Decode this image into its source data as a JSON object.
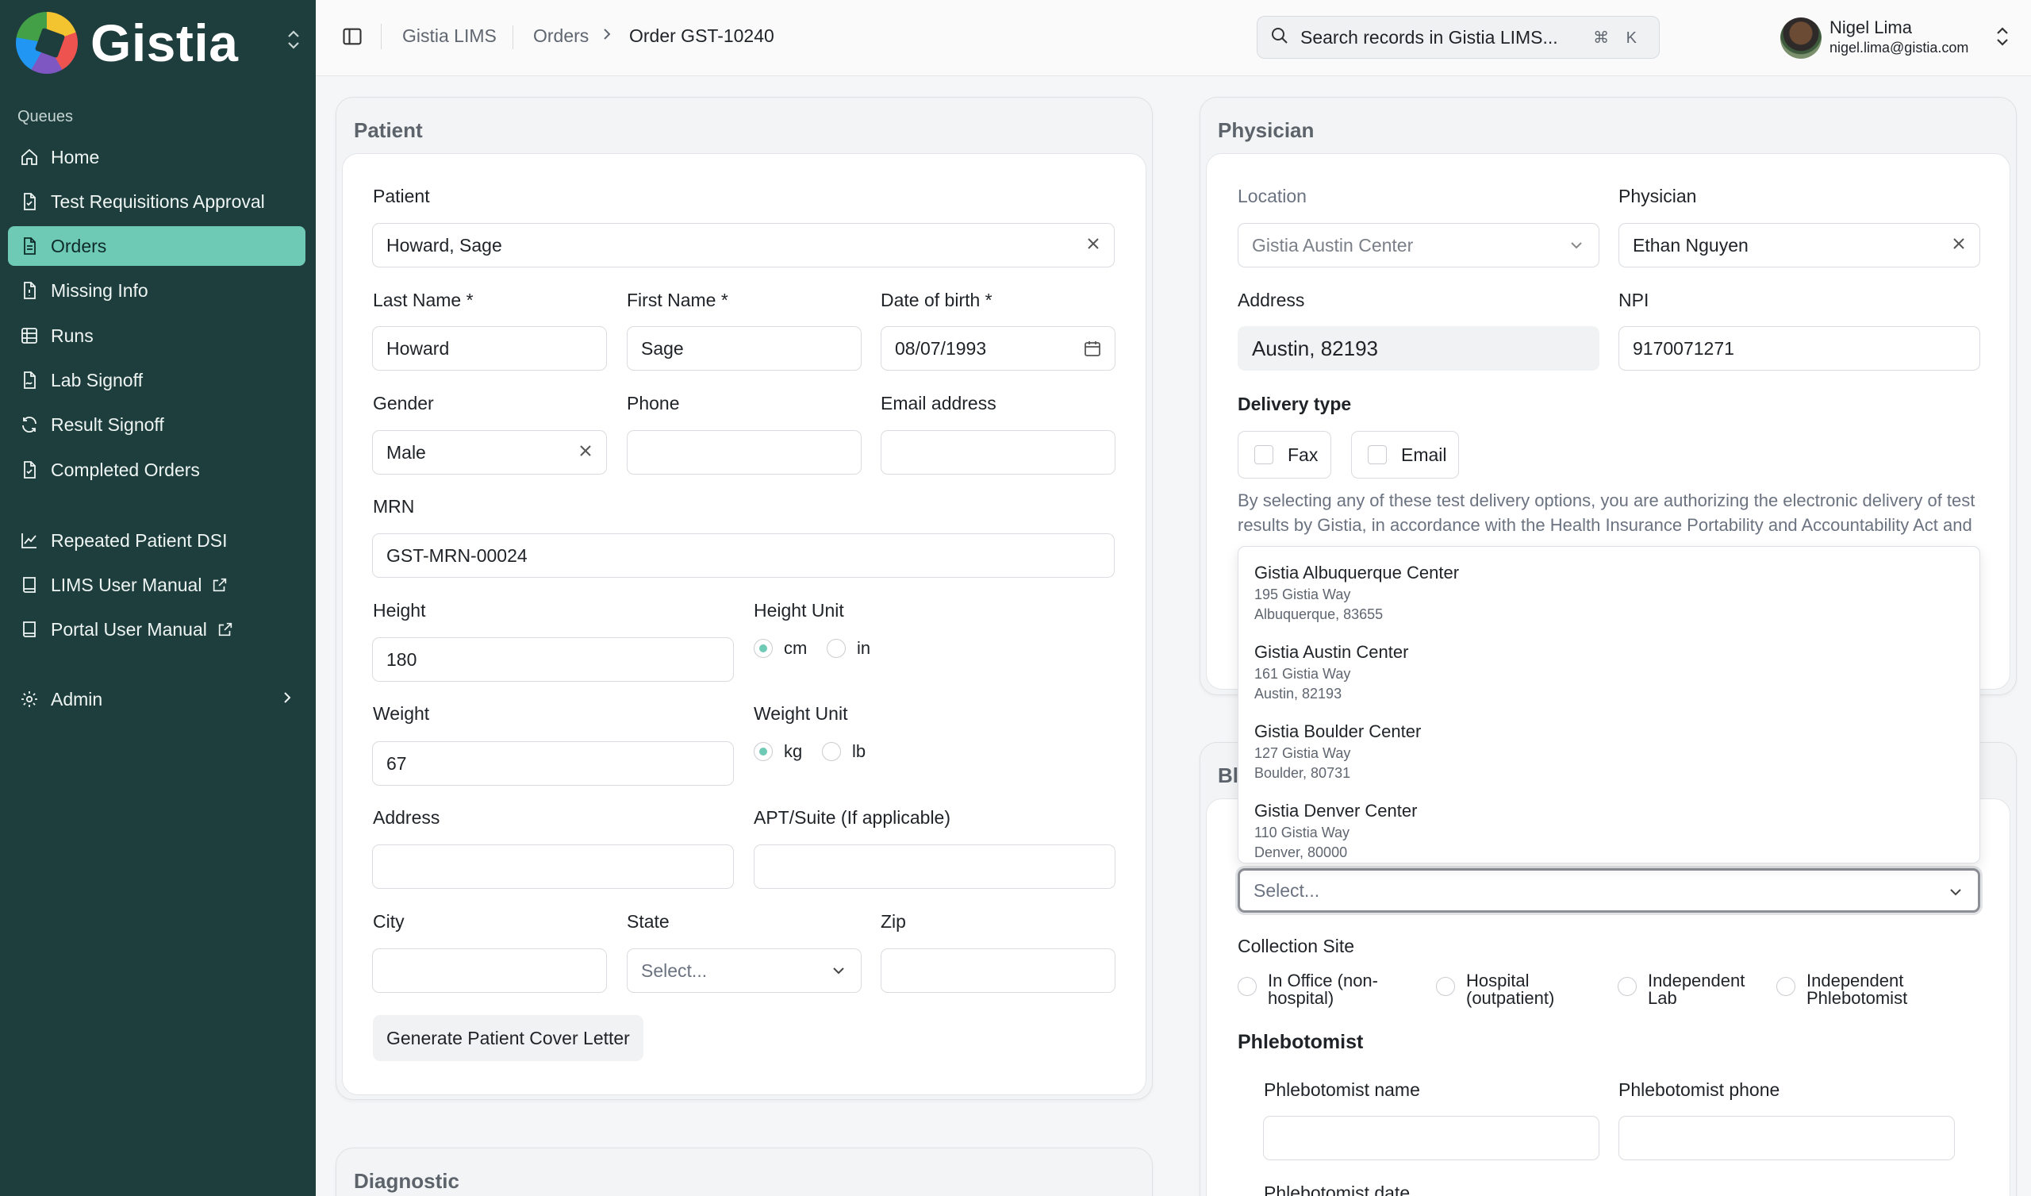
{
  "brand": {
    "name": "Gistia"
  },
  "sidebar": {
    "section_label": "Queues",
    "items": [
      {
        "label": "Home",
        "icon": "home-icon"
      },
      {
        "label": "Test Requisitions Approval",
        "icon": "file-check-icon"
      },
      {
        "label": "Orders",
        "icon": "file-text-icon",
        "active": true
      },
      {
        "label": "Missing Info",
        "icon": "file-alert-icon"
      },
      {
        "label": "Runs",
        "icon": "grid-icon"
      },
      {
        "label": "Lab Signoff",
        "icon": "file-signature-icon"
      },
      {
        "label": "Result Signoff",
        "icon": "refresh-icon"
      },
      {
        "label": "Completed Orders",
        "icon": "file-check-icon"
      }
    ],
    "links": [
      {
        "label": "Repeated Patient DSI",
        "icon": "chart-line-icon"
      },
      {
        "label": "LIMS User Manual",
        "icon": "book-icon"
      },
      {
        "label": "Portal User Manual",
        "icon": "book-icon"
      }
    ],
    "admin_label": "Admin"
  },
  "topbar": {
    "breadcrumb": [
      "Gistia LIMS",
      "Orders",
      "Order GST-10240"
    ],
    "search_placeholder": "Search records in Gistia LIMS...",
    "search_shortcut": "⌘ K",
    "user_name": "Nigel Lima",
    "user_email": "nigel.lima@gistia.com"
  },
  "patient": {
    "title": "Patient",
    "patient_label": "Patient",
    "patient_value": "Howard, Sage",
    "last_name_label": "Last Name *",
    "last_name": "Howard",
    "first_name_label": "First Name *",
    "first_name": "Sage",
    "dob_label": "Date of birth *",
    "dob": "08/07/1993",
    "gender_label": "Gender",
    "gender": "Male",
    "phone_label": "Phone",
    "phone": "",
    "email_label": "Email address",
    "email": "",
    "mrn_label": "MRN",
    "mrn": "GST-MRN-00024",
    "height_label": "Height",
    "height": "180",
    "height_unit_label": "Height Unit",
    "height_units": [
      "cm",
      "in"
    ],
    "height_unit_selected": "cm",
    "weight_label": "Weight",
    "weight": "67",
    "weight_unit_label": "Weight Unit",
    "weight_units": [
      "kg",
      "lb"
    ],
    "weight_unit_selected": "kg",
    "address_label": "Address",
    "address": "",
    "apt_label": "APT/Suite (If applicable)",
    "apt": "",
    "city_label": "City",
    "city": "",
    "state_label": "State",
    "state_placeholder": "Select...",
    "zip_label": "Zip",
    "zip": "",
    "cover_letter_button": "Generate Patient Cover Letter"
  },
  "diagnostic": {
    "title": "Diagnostic"
  },
  "physician": {
    "title": "Physician",
    "location_label": "Location",
    "location": "Gistia Austin Center",
    "physician_label": "Physician",
    "physician": "Ethan Nguyen",
    "address_label": "Address",
    "address": "Austin, 82193",
    "npi_label": "NPI",
    "npi": "9170071271",
    "delivery_label": "Delivery type",
    "delivery_options": [
      "Fax",
      "Email"
    ],
    "disclaimer_line1": "By selecting any of these test delivery options, you are authorizing the electronic delivery of test",
    "disclaimer_line2": "results by Gistia, in accordance with the Health Insurance Portability and Accountability Act and"
  },
  "location_dropdown": {
    "options": [
      {
        "name": "Gistia Albuquerque Center",
        "street": "195 Gistia Way",
        "city": "Albuquerque, 83655"
      },
      {
        "name": "Gistia Austin Center",
        "street": "161 Gistia Way",
        "city": "Austin, 82193"
      },
      {
        "name": "Gistia Boulder Center",
        "street": "127 Gistia Way",
        "city": "Boulder, 80731"
      },
      {
        "name": "Gistia Denver Center",
        "street": "110 Gistia Way",
        "city": "Denver, 80000"
      }
    ]
  },
  "blood": {
    "title_partial": "Bl",
    "select_placeholder": "Select...",
    "collection_site_label": "Collection Site",
    "collection_sites": [
      [
        "In Office (non-",
        "hospital)"
      ],
      [
        "Hospital",
        "(outpatient)"
      ],
      [
        "Independent",
        "Lab"
      ],
      [
        "Independent",
        "Phlebotomist"
      ]
    ],
    "phlebotomist_title": "Phlebotomist",
    "phlebotomist_name_label": "Phlebotomist name",
    "phlebotomist_phone_label": "Phlebotomist phone",
    "phlebotomist_date_label": "Phlebotomist date"
  }
}
